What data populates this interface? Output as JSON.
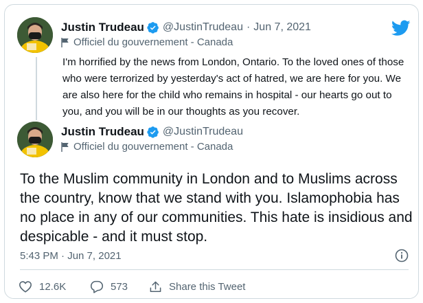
{
  "tweet1": {
    "author_name": "Justin Trudeau",
    "handle": "@JustinTrudeau",
    "separator": "·",
    "date": "Jun 7, 2021",
    "label": "Officiel du gouvernement - Canada",
    "text": "I'm horrified by the news from London, Ontario. To the loved ones of those who were terrorized by yesterday's act of hatred, we are here for you. We are also here for the child who remains in hospital - our hearts go out to you, and you will be in our thoughts as you recover."
  },
  "tweet2": {
    "author_name": "Justin Trudeau",
    "handle": "@JustinTrudeau",
    "label": "Officiel du gouvernement - Canada",
    "text": "To the Muslim community in London and to Muslims across the country, know that we stand with you. Islamophobia has no place in any of our communities. This hate is insidious and despicable - and it must stop.",
    "timestamp": "5:43 PM · Jun 7, 2021"
  },
  "actions": {
    "likes": "12.6K",
    "replies": "573",
    "share_label": "Share this Tweet"
  },
  "icons": {
    "brand": "twitter-bird-icon",
    "verified": "verified-badge-icon",
    "label": "flag-icon",
    "info": "info-icon",
    "like": "heart-icon",
    "reply": "reply-icon",
    "share": "share-icon"
  },
  "colors": {
    "brand_blue": "#1d9bf0",
    "text_primary": "#0f1419",
    "text_secondary": "#536471",
    "border": "#cfd9de"
  }
}
